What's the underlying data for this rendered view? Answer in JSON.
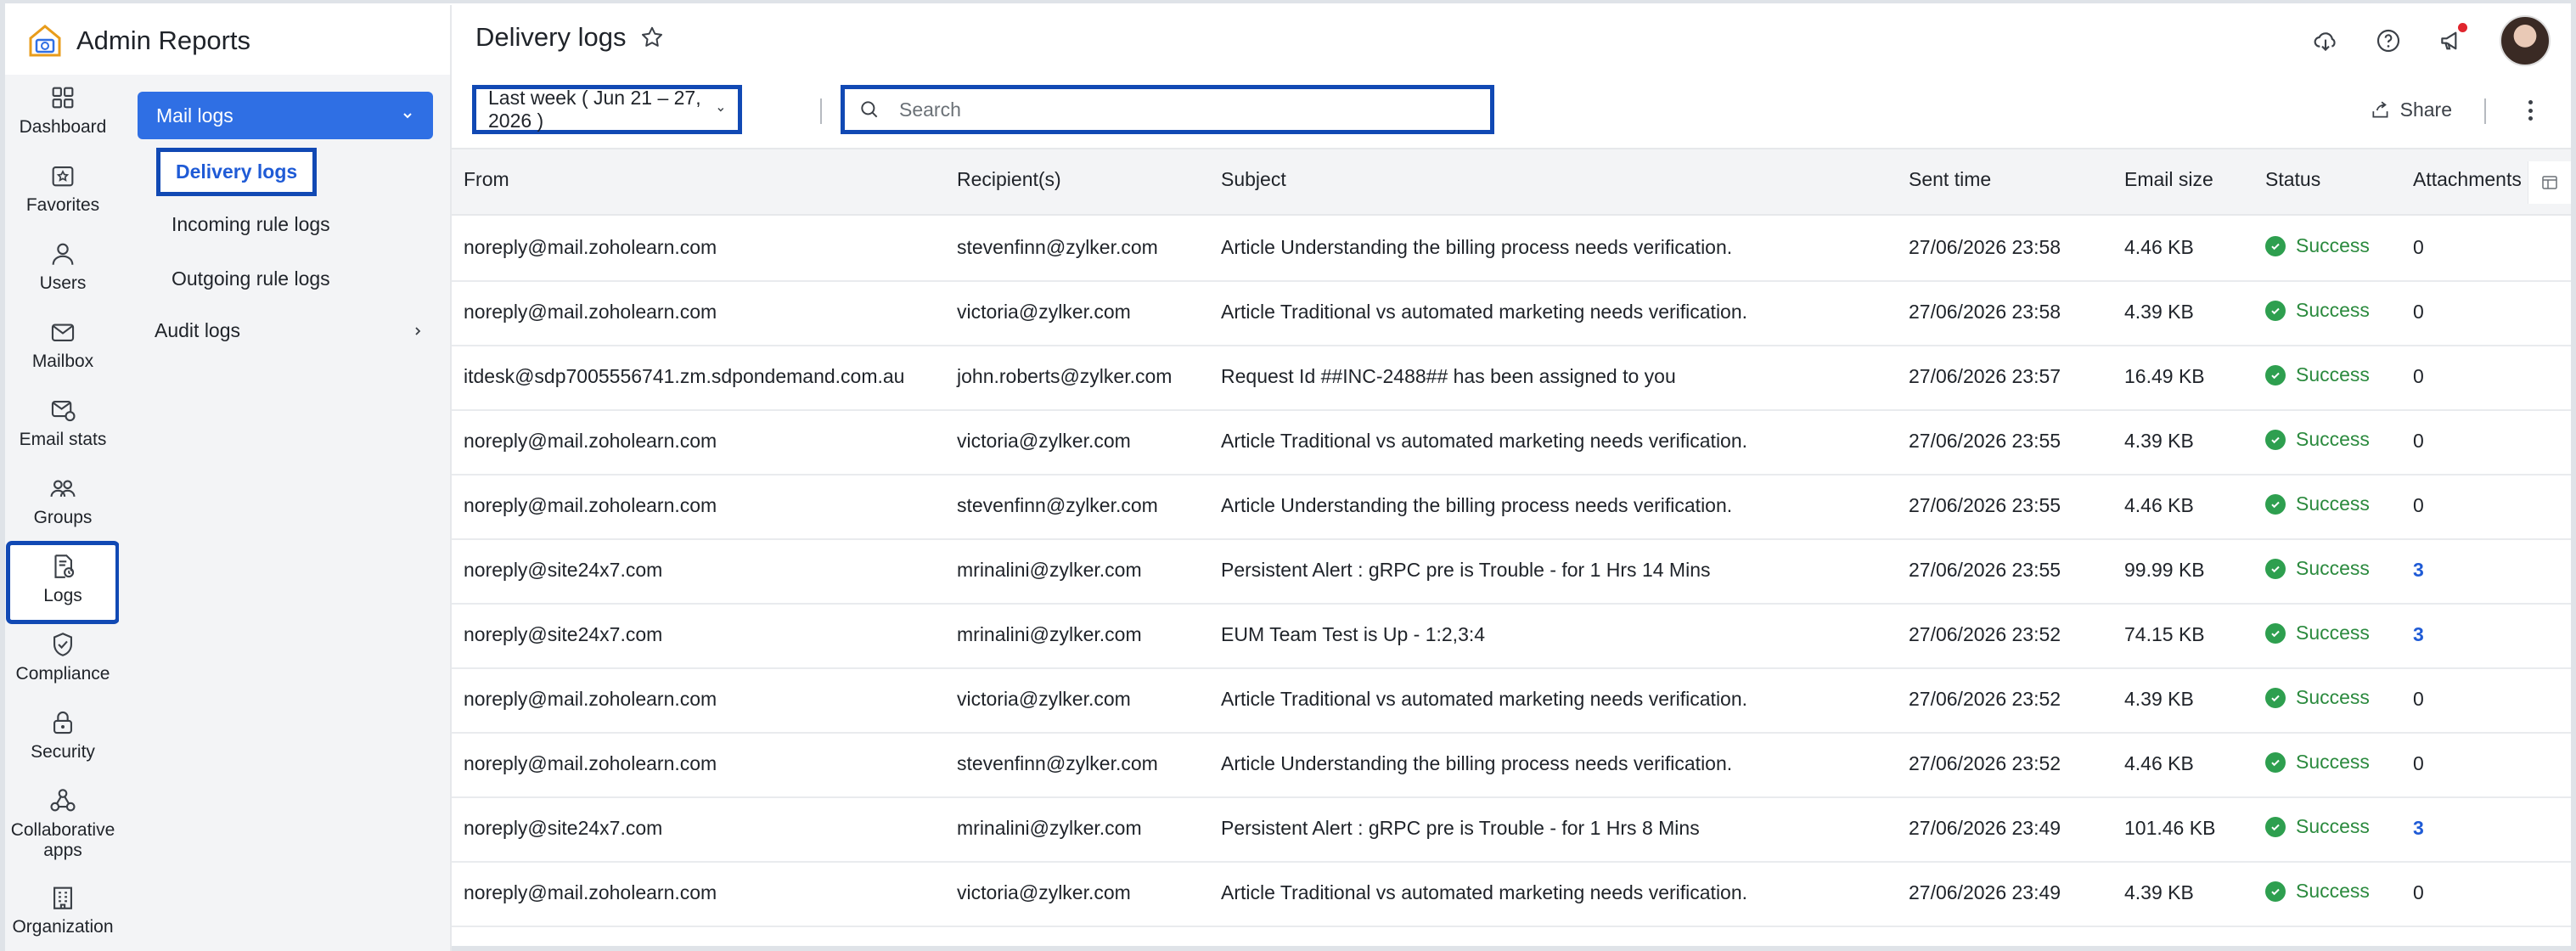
{
  "app": {
    "name": "Admin Reports"
  },
  "page": {
    "title": "Delivery logs"
  },
  "rail": {
    "items": [
      {
        "label": "Dashboard",
        "icon": "dashboard-icon"
      },
      {
        "label": "Favorites",
        "icon": "favorites-icon"
      },
      {
        "label": "Users",
        "icon": "user-icon"
      },
      {
        "label": "Mailbox",
        "icon": "mailbox-icon"
      },
      {
        "label": "Email stats",
        "icon": "email-stats-icon"
      },
      {
        "label": "Groups",
        "icon": "groups-icon"
      },
      {
        "label": "Logs",
        "icon": "logs-icon",
        "active": true
      },
      {
        "label": "Compliance",
        "icon": "compliance-icon"
      },
      {
        "label": "Security",
        "icon": "lock-icon"
      },
      {
        "label": "Collaborative apps",
        "icon": "collaborative-apps-icon"
      },
      {
        "label": "Organization",
        "icon": "organization-icon"
      }
    ]
  },
  "subnav": {
    "section": "Mail logs",
    "items": [
      {
        "label": "Delivery logs",
        "active": true
      },
      {
        "label": "Incoming rule logs"
      },
      {
        "label": "Outgoing rule logs"
      }
    ],
    "audit": "Audit logs"
  },
  "toolbar": {
    "date_range": "Last week ( Jun 21 – 27, 2026 )",
    "search_placeholder": "Search",
    "share_label": "Share"
  },
  "table": {
    "columns": [
      "From",
      "Recipient(s)",
      "Subject",
      "Sent time",
      "Email size",
      "Status",
      "Attachments"
    ],
    "rows": [
      [
        "noreply@mail.zoholearn.com",
        "stevenfinn@zylker.com",
        "Article Understanding the billing process needs verification.",
        "27/06/2026 23:58",
        "4.46 KB",
        "Success",
        "0"
      ],
      [
        "noreply@mail.zoholearn.com",
        "victoria@zylker.com",
        "Article Traditional vs automated marketing needs verification.",
        "27/06/2026 23:58",
        "4.39 KB",
        "Success",
        "0"
      ],
      [
        "itdesk@sdp7005556741.zm.sdpondemand.com.au",
        "john.roberts@zylker.com",
        "Request Id ##INC-2488## has been assigned to you",
        "27/06/2026 23:57",
        "16.49 KB",
        "Success",
        "0"
      ],
      [
        "noreply@mail.zoholearn.com",
        "victoria@zylker.com",
        "Article Traditional vs automated marketing needs verification.",
        "27/06/2026 23:55",
        "4.39 KB",
        "Success",
        "0"
      ],
      [
        "noreply@mail.zoholearn.com",
        "stevenfinn@zylker.com",
        "Article Understanding the billing process needs verification.",
        "27/06/2026 23:55",
        "4.46 KB",
        "Success",
        "0"
      ],
      [
        "noreply@site24x7.com",
        "mrinalini@zylker.com",
        "Persistent Alert : gRPC pre is Trouble - for 1 Hrs 14 Mins",
        "27/06/2026 23:55",
        "99.99 KB",
        "Success",
        "3"
      ],
      [
        "noreply@site24x7.com",
        "mrinalini@zylker.com",
        "EUM Team Test is Up - 1:2,3:4",
        "27/06/2026 23:52",
        "74.15 KB",
        "Success",
        "3"
      ],
      [
        "noreply@mail.zoholearn.com",
        "victoria@zylker.com",
        "Article Traditional vs automated marketing needs verification.",
        "27/06/2026 23:52",
        "4.39 KB",
        "Success",
        "0"
      ],
      [
        "noreply@mail.zoholearn.com",
        "stevenfinn@zylker.com",
        "Article Understanding the billing process needs verification.",
        "27/06/2026 23:52",
        "4.46 KB",
        "Success",
        "0"
      ],
      [
        "noreply@site24x7.com",
        "mrinalini@zylker.com",
        "Persistent Alert : gRPC pre is Trouble - for 1 Hrs 8 Mins",
        "27/06/2026 23:49",
        "101.46 KB",
        "Success",
        "3"
      ],
      [
        "noreply@mail.zoholearn.com",
        "victoria@zylker.com",
        "Article Traditional vs automated marketing needs verification.",
        "27/06/2026 23:49",
        "4.39 KB",
        "Success",
        "0"
      ]
    ]
  },
  "colors": {
    "accent": "#2f6fe4",
    "highlight": "#1149b4",
    "success": "#2b8a3e",
    "link": "#1f5bd6"
  }
}
